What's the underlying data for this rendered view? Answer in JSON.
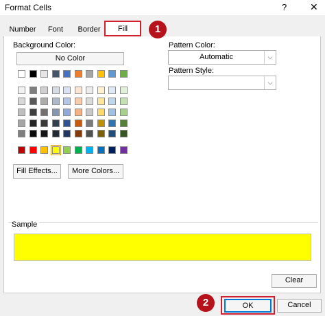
{
  "window": {
    "title": "Format Cells",
    "help_glyph": "?",
    "close_glyph": "✕"
  },
  "tabs": [
    {
      "label": "Number"
    },
    {
      "label": "Font"
    },
    {
      "label": "Border"
    },
    {
      "label": "Fill",
      "selected": true
    }
  ],
  "annotations": {
    "badge1": "1",
    "badge2": "2"
  },
  "fill": {
    "background_color_label": "Background Color:",
    "no_color_button": "No Color",
    "fill_effects_button": "Fill Effects...",
    "more_colors_button": "More Colors...",
    "pattern_color_label": "Pattern Color:",
    "pattern_color_value": "Automatic",
    "pattern_style_label": "Pattern Style:",
    "pattern_style_value": "",
    "sample_label": "Sample",
    "sample_color": "#ffff00",
    "selected_swatch": "#ffff00"
  },
  "palette": {
    "theme_row": [
      "#ffffff",
      "#000000",
      "#e7e6e6",
      "#44546a",
      "#4472c4",
      "#ed7d31",
      "#a5a5a5",
      "#ffc000",
      "#5b9bd5",
      "#70ad47"
    ],
    "tint_rows": [
      [
        "#f2f2f2",
        "#7f7f7f",
        "#d0cece",
        "#d6dce4",
        "#d9e2f3",
        "#fbe5d5",
        "#ededed",
        "#fff2cc",
        "#deebf6",
        "#e2efd9"
      ],
      [
        "#d8d8d8",
        "#595959",
        "#aeabab",
        "#adb9ca",
        "#b4c6e7",
        "#f7cbac",
        "#dbdbdb",
        "#ffe598",
        "#bdd7ee",
        "#c5e0b3"
      ],
      [
        "#bfbfbf",
        "#3f3f3f",
        "#757070",
        "#8496b0",
        "#8eaadb",
        "#f4b183",
        "#c9c9c9",
        "#ffd965",
        "#9cc3e5",
        "#a8d08d"
      ],
      [
        "#a5a5a5",
        "#262626",
        "#3a3838",
        "#323f4f",
        "#2f5496",
        "#c55a11",
        "#7b7b7b",
        "#bf9000",
        "#2e75b5",
        "#538135"
      ],
      [
        "#7f7f7f",
        "#0c0c0c",
        "#171616",
        "#222a35",
        "#1f3864",
        "#833c0b",
        "#525252",
        "#7f6000",
        "#1e4e79",
        "#375623"
      ]
    ],
    "standard_row": [
      "#c00000",
      "#ff0000",
      "#ffc000",
      "#ffff00",
      "#92d050",
      "#00b050",
      "#00b0f0",
      "#0070c0",
      "#002060",
      "#7030a0"
    ]
  },
  "footer": {
    "clear_button": "Clear",
    "ok_button": "OK",
    "cancel_button": "Cancel"
  }
}
